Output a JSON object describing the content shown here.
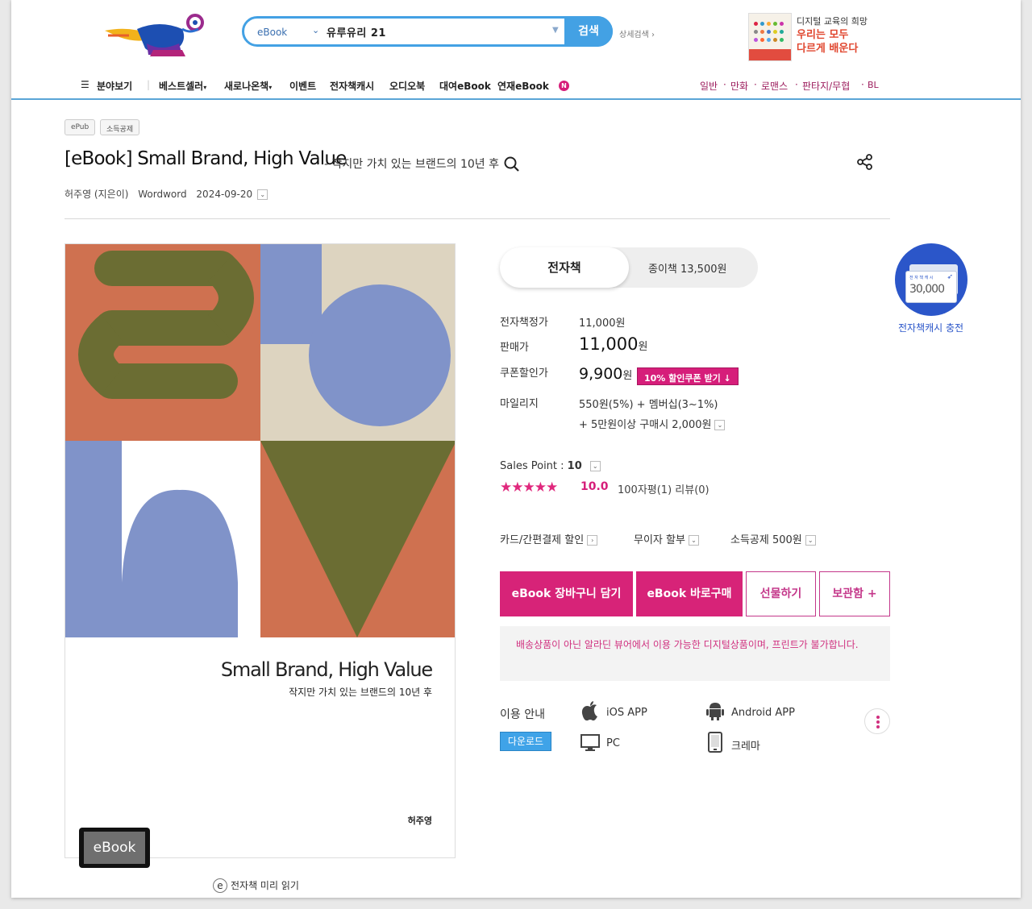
{
  "header": {
    "search": {
      "category": "eBook",
      "query": "유루유리 21",
      "button_label": "검색"
    },
    "advanced_search_label": "상세검색 ›",
    "ad": {
      "line1": "디지털 교육의 희망",
      "line2": "우리는 모두",
      "line3": "다르게 배운다"
    },
    "nav": {
      "items": [
        "분야보기",
        "베스트셀러",
        "새로나온책",
        "이벤트",
        "전자책캐시",
        "오디오북",
        "대여eBook",
        "연재eBook"
      ],
      "new_badge": "N",
      "genres": [
        "일반",
        "만화",
        "로맨스",
        "판타지/무협",
        "BL"
      ]
    }
  },
  "product": {
    "tags": [
      "ePub",
      "소득공제"
    ],
    "title": "[eBook] Small Brand, High Value",
    "subtitle": "- 작지만 가치 있는 브랜드의 10년 후",
    "author": "허주영 (지은이)",
    "publisher": "Wordword",
    "date": "2024-09-20"
  },
  "cover": {
    "title": "Small Brand, High Value",
    "subtitle": "작지만 가치 있는 브랜드의 10년 후",
    "author": "허주영",
    "badge": "eBook",
    "preview_icon": "e",
    "preview_label": "전자책 미리 읽기",
    "colors": {
      "terracotta": "#cf7150",
      "olive": "#6b6d33",
      "periwinkle": "#8093c9",
      "beige": "#ddd4c0"
    }
  },
  "format_tabs": {
    "active": "전자책",
    "inactive": "종이책 13,500원"
  },
  "pricing": {
    "list_label": "전자책정가",
    "list_value": "11,000원",
    "sale_label": "판매가",
    "sale_value": "11,000",
    "sale_unit": "원",
    "coupon_label": "쿠폰할인가",
    "coupon_value": "9,900",
    "coupon_unit": "원",
    "coupon_button": "10% 할인쿠폰 받기 ↓",
    "mileage_label": "마일리지",
    "mileage_line1": "550원(5%) + 멤버십(3~1%)",
    "mileage_line2": "+ 5만원이상 구매시 2,000원"
  },
  "rating": {
    "sales_point_label": "Sales Point : ",
    "sales_point_value": "10",
    "stars": "★★★★★",
    "score": "10.0",
    "review_text": "100자평(1)  리뷰(0)"
  },
  "options": {
    "card_discount": "카드/간편결제 할인",
    "installment": "무이자 할부",
    "tax_deduction": "소득공제 500원"
  },
  "actions": {
    "cart": "eBook 장바구니 담기",
    "buy": "eBook 바로구매",
    "gift": "선물하기",
    "storage": "보관함 +"
  },
  "notice": "배송상품이 아닌 알라딘 뷰어에서 이용 가능한 디지털상품이며, 프린트가 불가합니다.",
  "usage": {
    "label": "이용 안내",
    "download_button": "다운로드",
    "platforms": [
      "iOS APP",
      "Android APP",
      "PC",
      "크레마"
    ]
  },
  "cash_card": {
    "card_text": "전 자 책 캐 시",
    "amount": "30,000",
    "label": "전자책캐시 충전"
  },
  "colors": {
    "accent_pink": "#d72378",
    "accent_blue": "#43a1e4",
    "nav_line": "#5aa5d6"
  }
}
